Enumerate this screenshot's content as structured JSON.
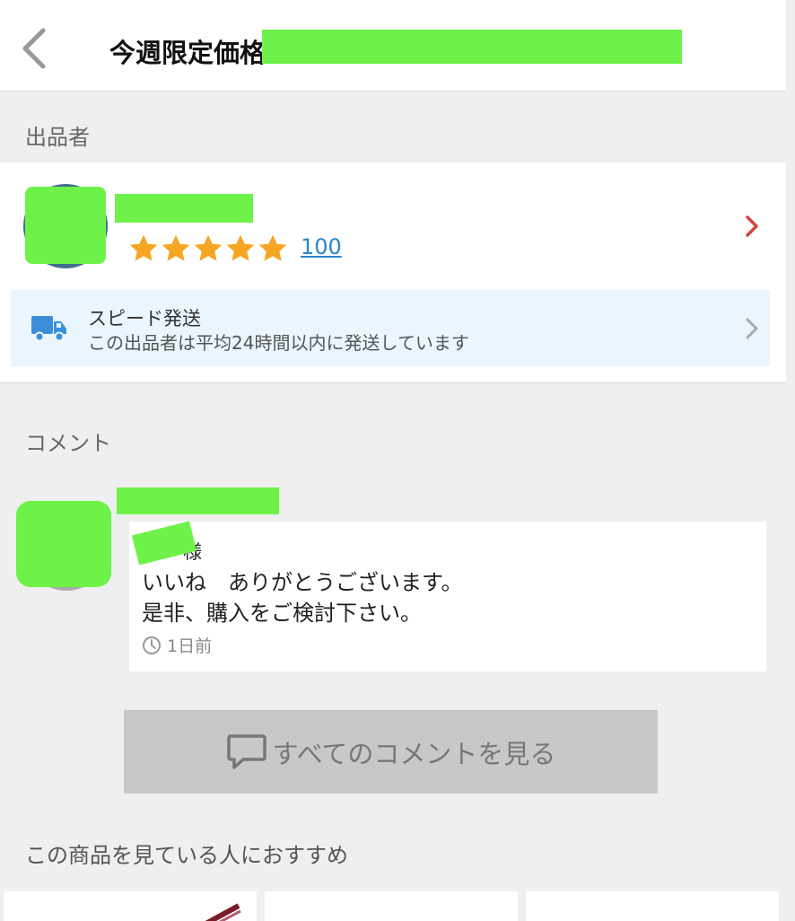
{
  "header": {
    "title": "今週限定価格"
  },
  "seller_section": {
    "label": "出品者",
    "rating_count": "100",
    "speed": {
      "title": "スピード発送",
      "description": "この出品者は平均24時間以内に発送しています"
    }
  },
  "comments_section": {
    "label": "コメント",
    "comment": {
      "greeting": "様",
      "line1": "いいね　ありがとうございます。",
      "line2": "是非、購入をご検討下さい。",
      "time": "1日前"
    },
    "view_all_label": "すべてのコメントを見る"
  },
  "recommend": {
    "label": "この商品を見ている人におすすめ"
  },
  "colors": {
    "star": "#f5a623",
    "link": "#2a86c8",
    "seller_chevron": "#d0463a",
    "speed_bg": "#eaf5fd",
    "truck": "#3b8fd9",
    "redaction": "#6ef24a"
  },
  "icons": [
    "back-chevron-icon",
    "star-icon",
    "chevron-right-icon",
    "truck-icon",
    "clock-icon",
    "speech-bubble-icon"
  ]
}
